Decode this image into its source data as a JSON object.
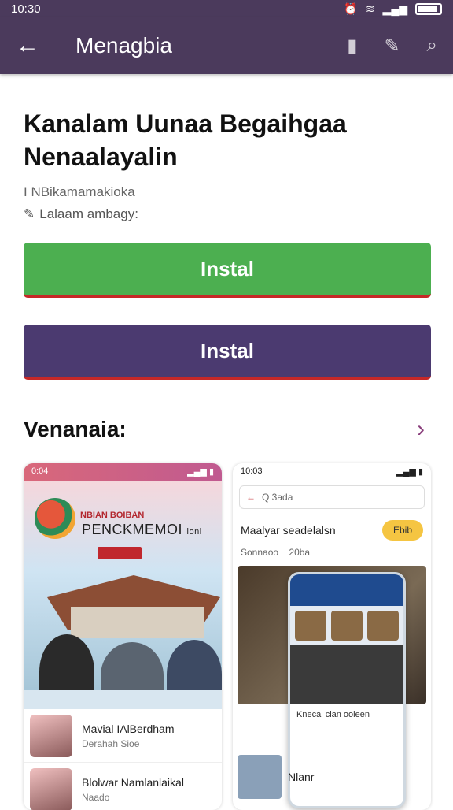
{
  "status_bar": {
    "time": "10:30"
  },
  "app_bar": {
    "title": "Menagbia"
  },
  "app": {
    "title": "Kanalam Uunaa Begaihgaa Nenaalayalin",
    "developer": "I NBikamamakioka",
    "meta": "Lalaam ambagy:"
  },
  "buttons": {
    "primary_label": "Instal",
    "secondary_label": "Instal"
  },
  "colors": {
    "primary_button": "#4caf50",
    "secondary_button": "#4b3a70",
    "app_bar": "#4b3a5c",
    "accent_underline": "#c62828"
  },
  "section": {
    "title": "Venanaia:"
  },
  "screenshot_a": {
    "time": "0:04",
    "banner_small": "NBIAN BOIBAN",
    "banner_large": "PENCKMEMOI",
    "banner_suffix": "ioni",
    "rows": [
      {
        "title": "Mavial IAlBerdham",
        "subtitle": "Derahah Sioe"
      },
      {
        "title": "Blolwar Namlanlaikal",
        "subtitle": "Naado"
      }
    ]
  },
  "screenshot_b": {
    "time": "10:03",
    "search_placeholder": "Q 3ada",
    "heading": "Maalyar seadelalsn",
    "pill_label": "Ebib",
    "sub_a": "Sonnaoo",
    "sub_b": "20ba",
    "phone_row": "Knecal clan ooleen",
    "bottom_label": "Nlanr"
  },
  "icons": {
    "back": "arrow-left-icon",
    "bookmark": "bookmark-icon",
    "edit": "edit-icon",
    "search": "search-icon",
    "chevron": "chevron-right-icon"
  }
}
